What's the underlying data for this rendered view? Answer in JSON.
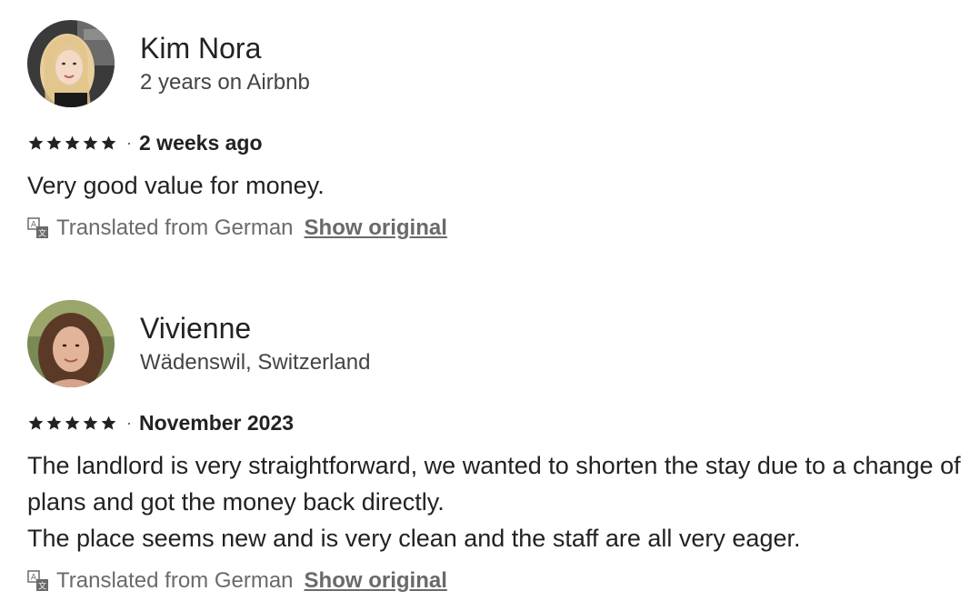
{
  "reviews": [
    {
      "reviewer_name": "Kim Nora",
      "reviewer_meta": "2 years on Airbnb",
      "avatar": "user-avatar-photo",
      "rating": 5,
      "separator": "·",
      "date": "2 weeks ago",
      "text": "Very good value for money.",
      "translated_label": "Translated from German",
      "show_original_label": "Show original"
    },
    {
      "reviewer_name": "Vivienne",
      "reviewer_meta": "Wädenswil, Switzerland",
      "avatar": "user-avatar-photo",
      "rating": 5,
      "separator": "·",
      "date": "November 2023",
      "text": "The landlord is very straightforward, we wanted to shorten the stay due to a change of plans and got the money back directly.\nThe place seems new and is very clean and the staff are all very eager.",
      "translated_label": "Translated from German",
      "show_original_label": "Show original"
    }
  ],
  "icons": {
    "star": "star-icon",
    "translate": "translate-icon"
  },
  "colors": {
    "text_primary": "#222222",
    "text_secondary": "#6a6a6a",
    "star": "#222222"
  }
}
